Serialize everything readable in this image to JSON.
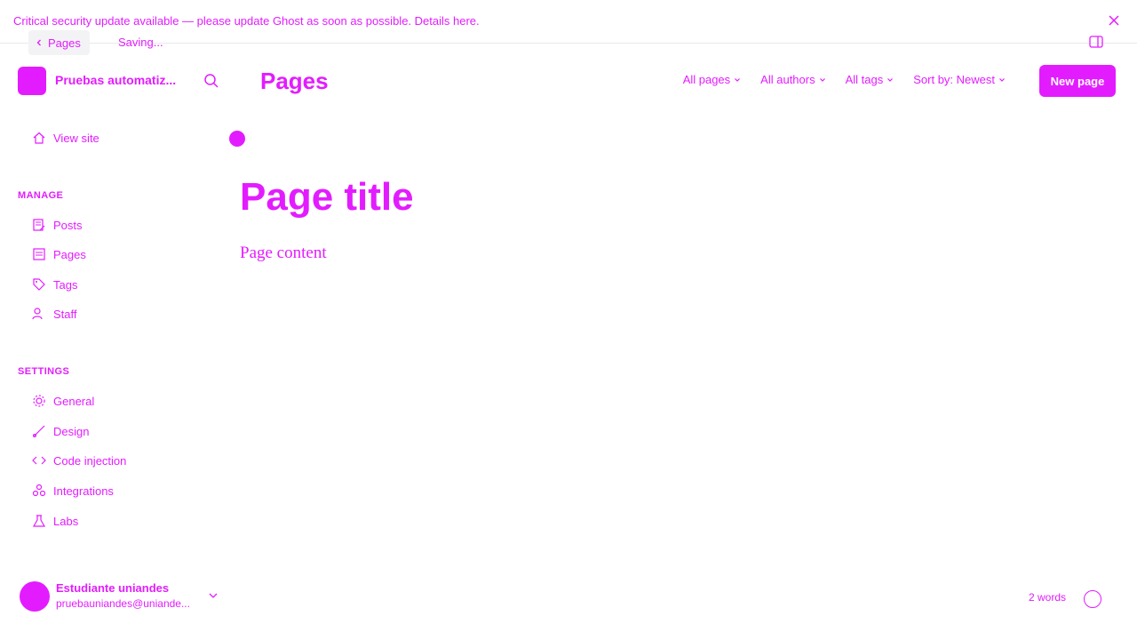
{
  "banner": {
    "message": "Critical security update available — please update Ghost as soon as possible. Details here.",
    "close_icon": "close-icon"
  },
  "editor": {
    "back_label": "Pages",
    "status": "Saving...",
    "word_count": "2 words",
    "title": "Page title",
    "content": "Page content"
  },
  "site": {
    "name": "Pruebas automatiz..."
  },
  "header": {
    "heading": "Pages",
    "filters": [
      {
        "label": "All pages"
      },
      {
        "label": "All authors"
      },
      {
        "label": "All tags"
      },
      {
        "label": "Sort by: Newest"
      }
    ],
    "new_button": "New page"
  },
  "sidebar": {
    "view_site": "View site",
    "manage_label": "MANAGE",
    "manage_items": [
      {
        "label": "Posts",
        "icon": "posts-icon"
      },
      {
        "label": "Pages",
        "icon": "pages-icon"
      },
      {
        "label": "Tags",
        "icon": "tag-icon"
      },
      {
        "label": "Staff",
        "icon": "staff-icon"
      }
    ],
    "settings_label": "SETTINGS",
    "settings_items": [
      {
        "label": "General",
        "icon": "gear-icon"
      },
      {
        "label": "Design",
        "icon": "brush-icon"
      },
      {
        "label": "Code injection",
        "icon": "code-icon"
      },
      {
        "label": "Integrations",
        "icon": "integrations-icon"
      },
      {
        "label": "Labs",
        "icon": "flask-icon"
      }
    ]
  },
  "user": {
    "name": "Estudiante uniandes",
    "email": "pruebauniandes@uniande..."
  },
  "colors": {
    "accent": "#e31cff"
  }
}
